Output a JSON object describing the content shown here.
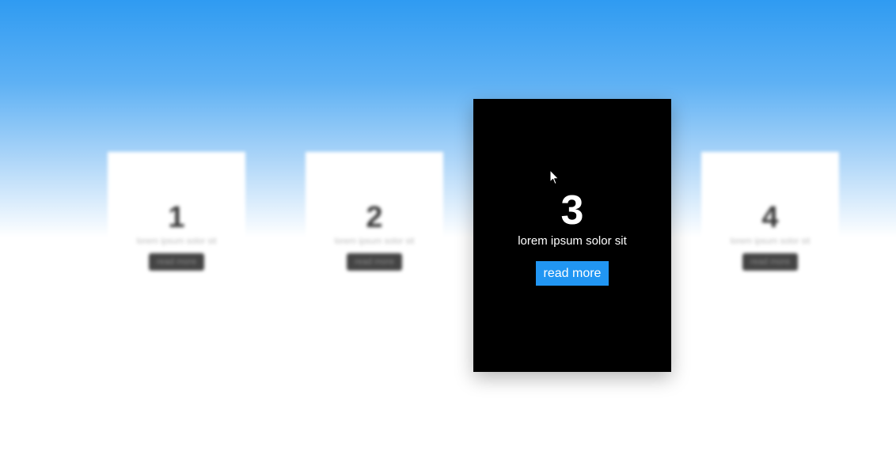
{
  "cards": [
    {
      "number": "1",
      "text": "lorem ipsum solor sit",
      "button": "read more"
    },
    {
      "number": "2",
      "text": "lorem ipsum solor sit",
      "button": "read more"
    },
    {
      "number": "3",
      "text": "lorem ipsum solor sit",
      "button": "read more"
    },
    {
      "number": "4",
      "text": "lorem ipsum solor sit",
      "button": "read more"
    }
  ],
  "colors": {
    "gradient_top": "#2f9bf2",
    "active_card_bg": "#000000",
    "button_accent": "#2196f3",
    "page_bg": "#ffffff"
  },
  "icons": {
    "cursor": "arrow-cursor-icon"
  }
}
